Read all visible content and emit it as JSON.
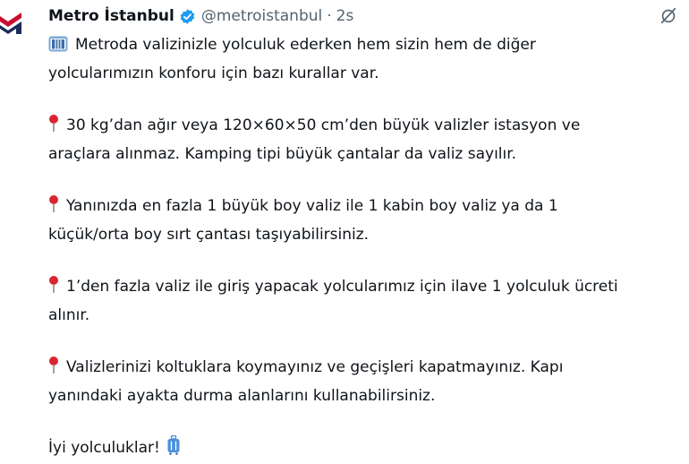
{
  "tweet": {
    "display_name": "Metro İstanbul",
    "handle": "@metroistanbul",
    "separator": "·",
    "time": "2s",
    "icons": {
      "avatar": "metro-istanbul-logo",
      "verified": "verified-badge-icon",
      "mute": "mute-icon",
      "pin": "round-pushpin-icon",
      "luggage_bullet": "luggage-icon",
      "luggage_end": "luggage-icon"
    },
    "colors": {
      "brand_red": "#c8102e",
      "brand_navy": "#1c2b5a",
      "verified_blue": "#1d9bf0",
      "pin_red": "#d9262e",
      "luggage_blue": "#4a90d9"
    },
    "lines": {
      "intro_1": "Metroda valizinizle yolculuk ederken hem sizin hem de diğer",
      "intro_2": "yolcularımızın konforu için bazı kurallar var.",
      "rule1_1": "30 kg’dan ağır veya 120×60×50 cm’den büyük valizler istasyon ve",
      "rule1_2": "araçlara alınmaz. Kamping tipi büyük çantalar da valiz sayılır.",
      "rule2_1": "Yanınızda en fazla 1 büyük boy valiz ile 1 kabin boy valiz ya da 1",
      "rule2_2": "küçük/orta boy sırt çantası taşıyabilirsiniz.",
      "rule3_1": "1’den fazla valiz ile giriş yapacak yolcularımız için ilave 1 yolculuk ücreti",
      "rule3_2": "alınır.",
      "rule4_1": "Valizlerinizi koltuklara koymayınız ve geçişleri kapatmayınız. Kapı",
      "rule4_2": "yanındaki ayakta durma alanlarını kullanabilirsiniz.",
      "closing": "İyi yolculuklar!"
    }
  }
}
